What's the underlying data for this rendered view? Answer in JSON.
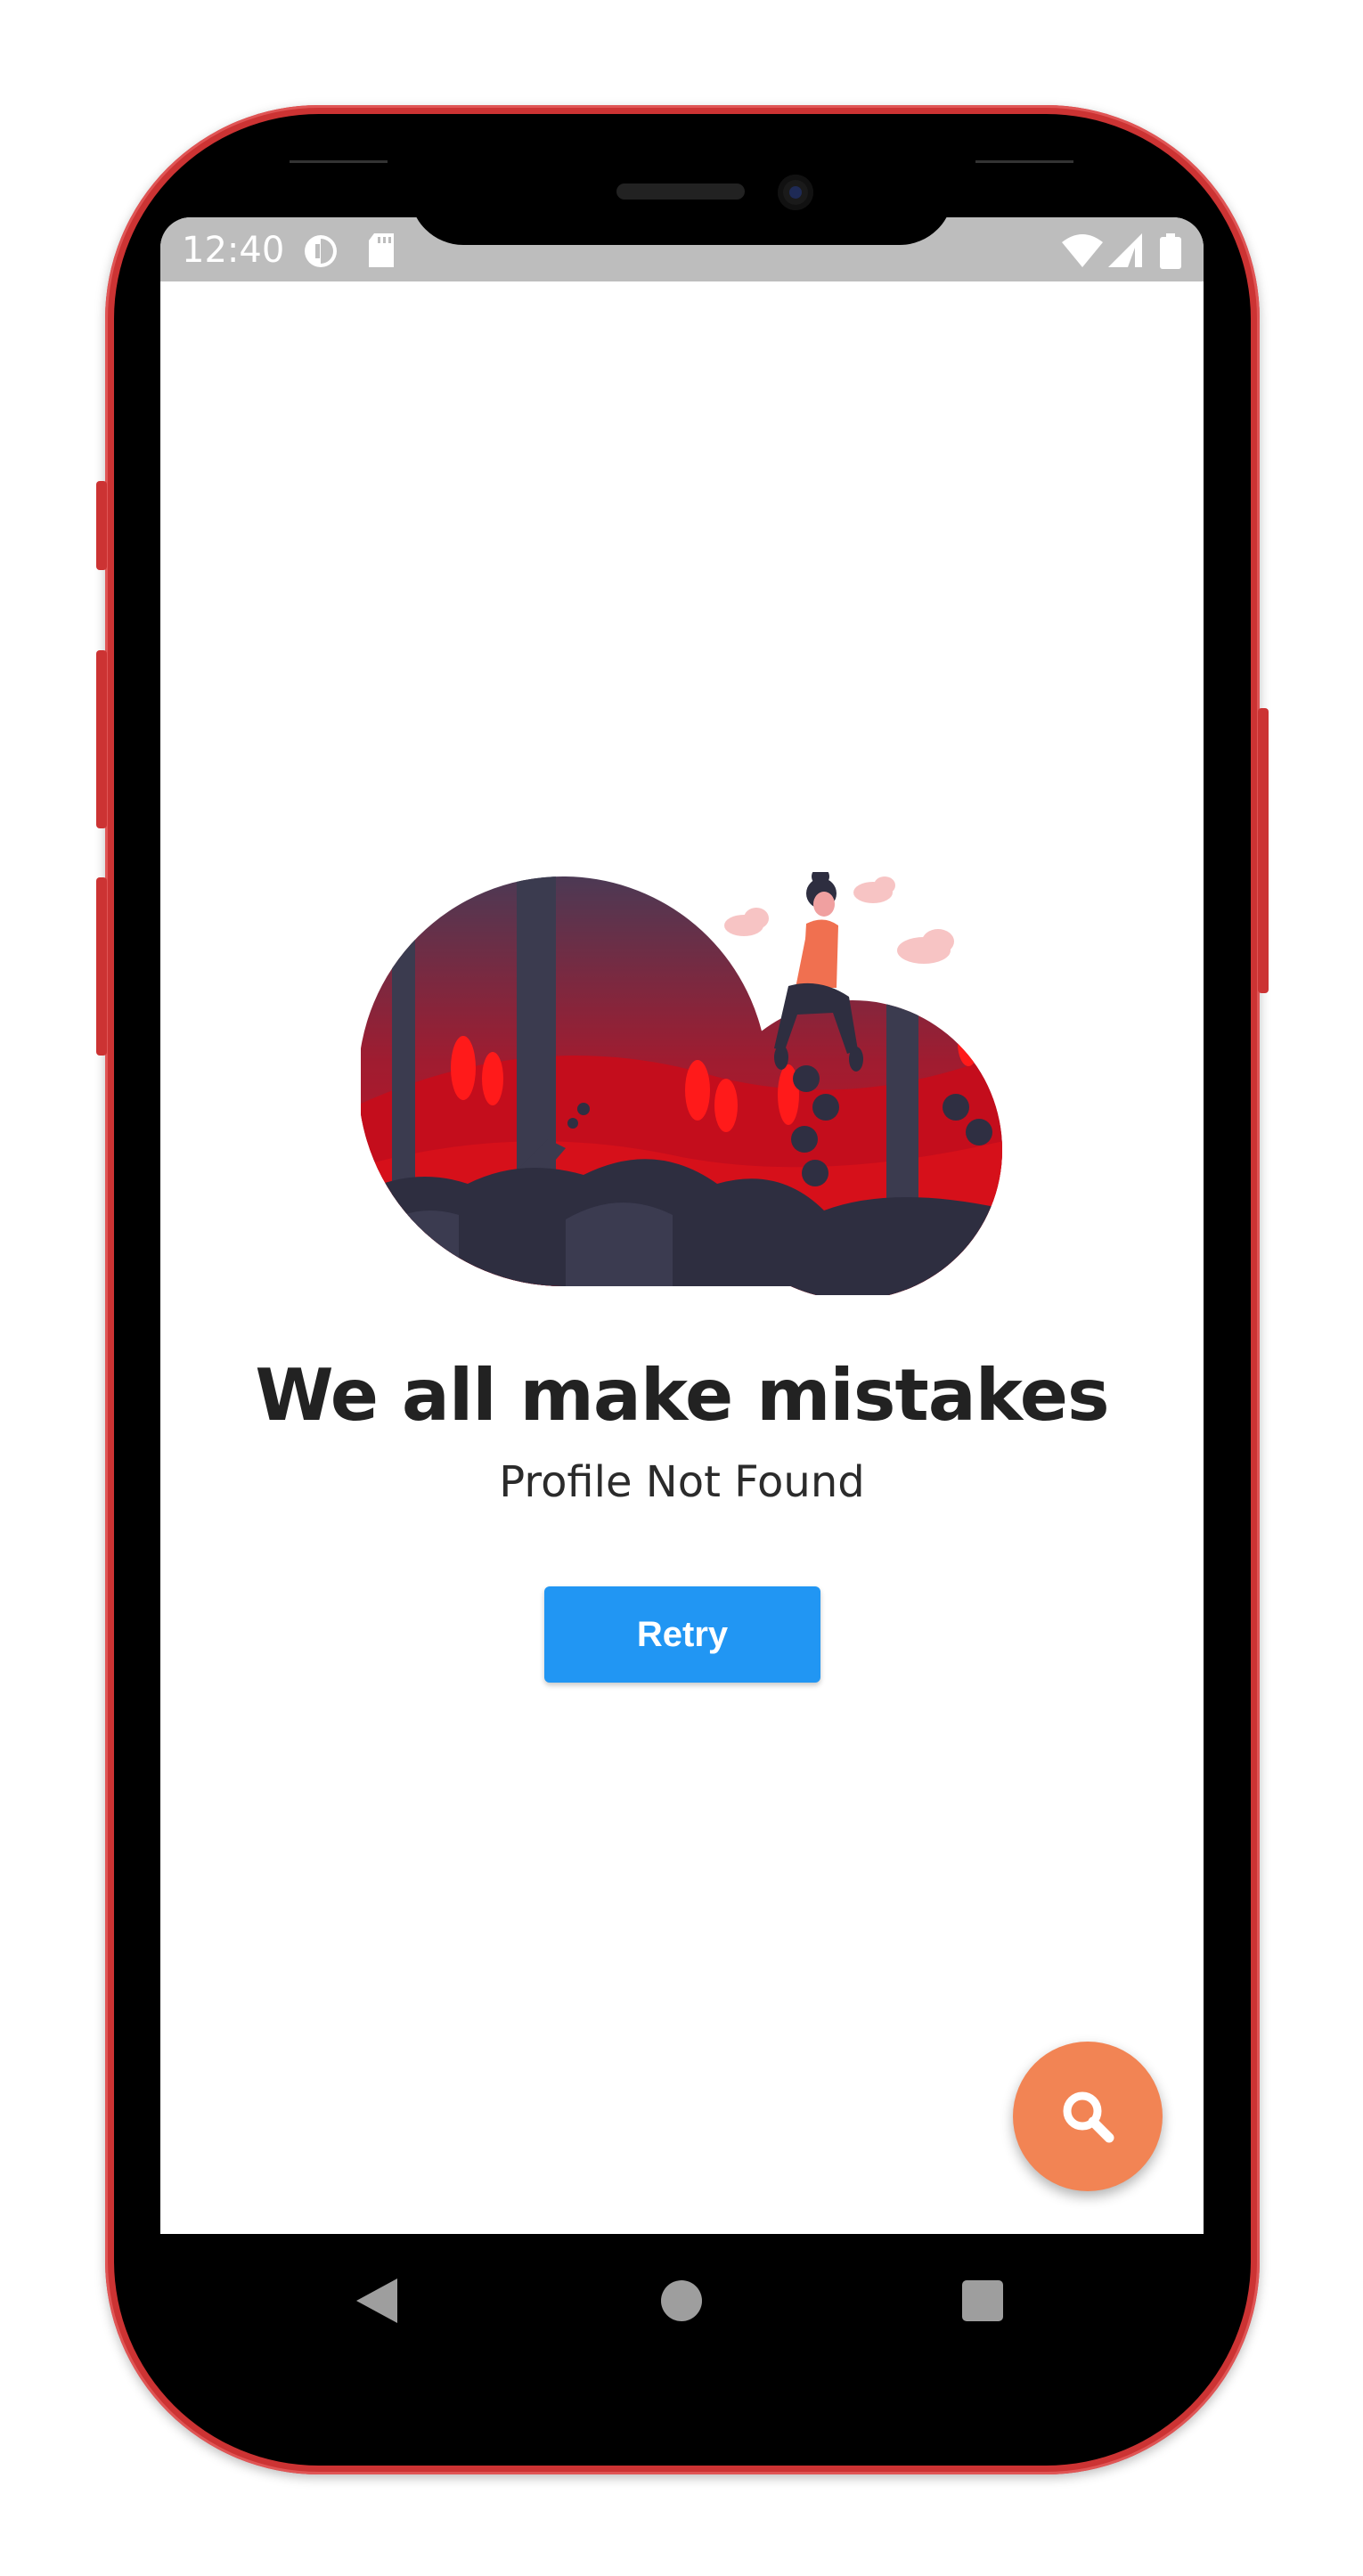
{
  "status_bar": {
    "time": "12:40",
    "icons": [
      "data-saver-icon",
      "sd-card-icon",
      "wifi-icon",
      "signal-icon",
      "battery-icon"
    ]
  },
  "content": {
    "headline": "We all make mistakes",
    "subtitle": "Profile Not Found",
    "retry_label": "Retry"
  },
  "fab": {
    "icon": "search-icon",
    "color": "#f28454"
  },
  "navigation": {
    "icons": [
      "back-icon",
      "home-icon",
      "recents-icon"
    ]
  },
  "colors": {
    "accent": "#2196f3",
    "illustration_red": "#c8102e",
    "illustration_dark": "#3b3b4f",
    "phone_frame": "#cc3333"
  }
}
